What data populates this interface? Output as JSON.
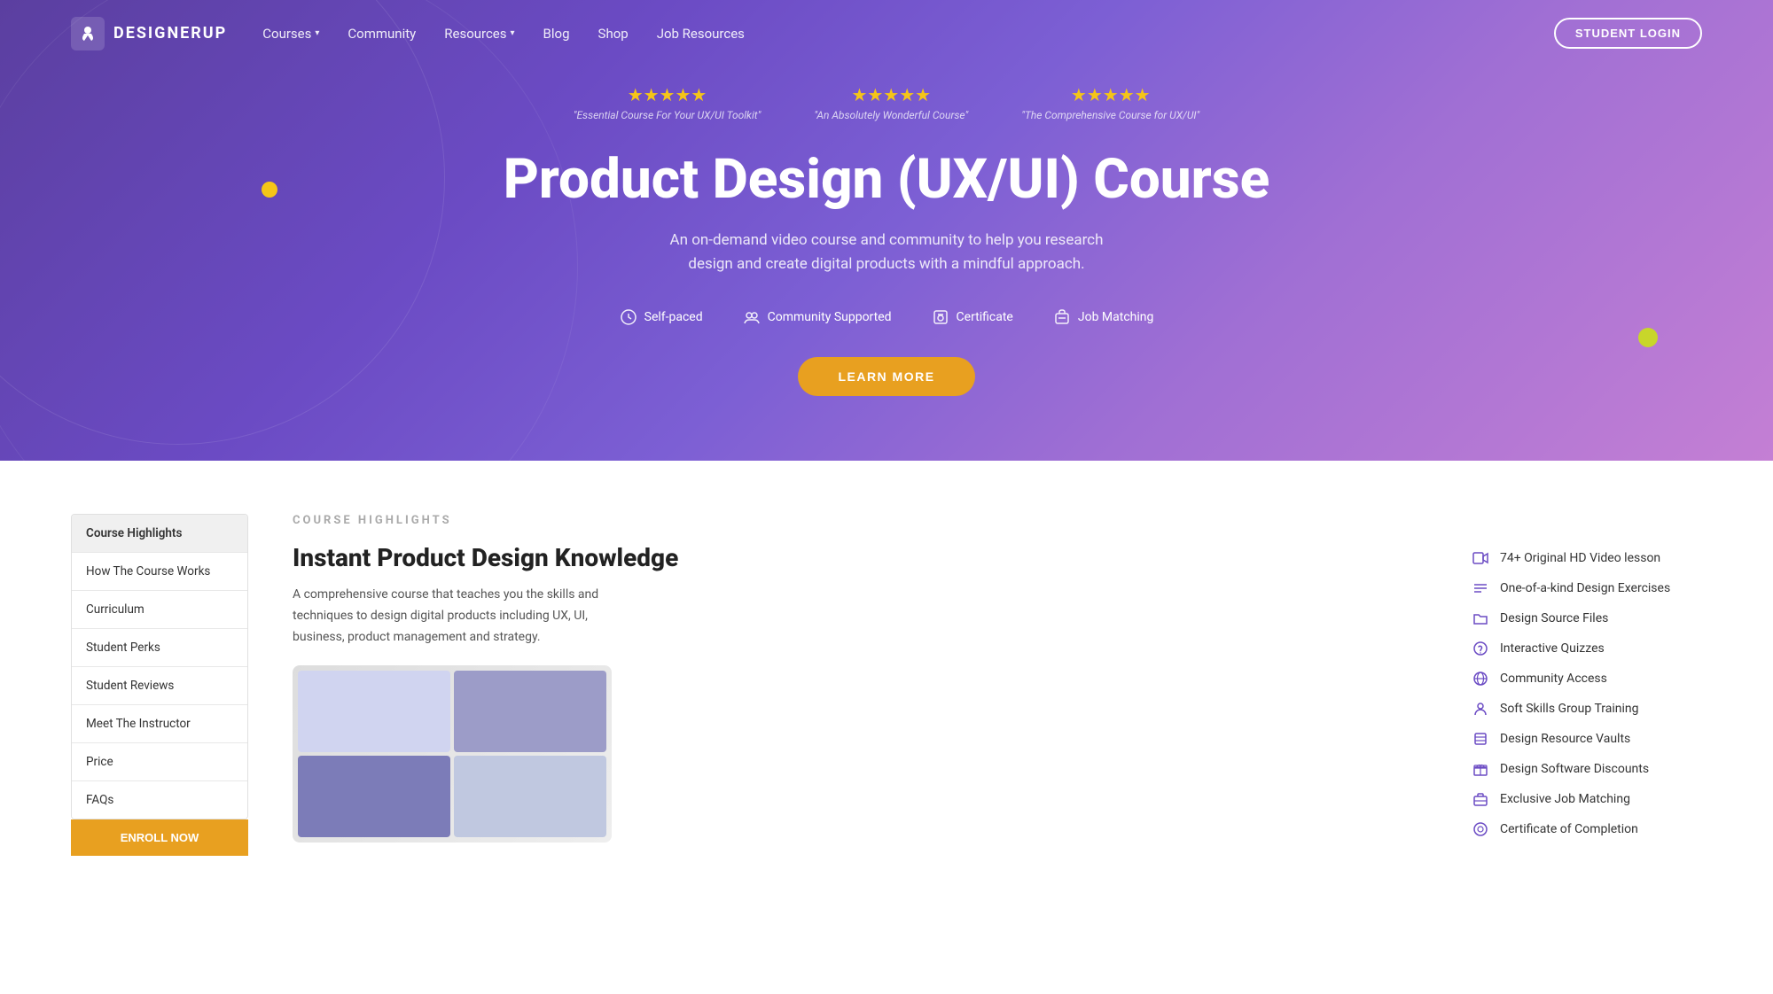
{
  "nav": {
    "logo_text": "DESIGNERUP",
    "links": [
      {
        "label": "Courses",
        "has_dropdown": true
      },
      {
        "label": "Community",
        "has_dropdown": false
      },
      {
        "label": "Resources",
        "has_dropdown": true
      },
      {
        "label": "Blog",
        "has_dropdown": false
      },
      {
        "label": "Shop",
        "has_dropdown": false
      },
      {
        "label": "Job Resources",
        "has_dropdown": false
      }
    ],
    "cta_label": "STUDENT LOGIN"
  },
  "hero": {
    "reviews": [
      {
        "stars": "★★★★★",
        "text": "\"Essential Course For Your UX/UI Toolkit\""
      },
      {
        "stars": "★★★★★",
        "text": "\"An Absolutely Wonderful Course\""
      },
      {
        "stars": "★★★★★",
        "text": "\"The Comprehensive Course for UX/UI\""
      }
    ],
    "title": "Product Design (UX/UI) Course",
    "subtitle": "An on-demand video course and community to help you research design and create digital products with a mindful approach.",
    "features": [
      {
        "icon": "clock",
        "label": "Self-paced"
      },
      {
        "icon": "users",
        "label": "Community Supported"
      },
      {
        "icon": "certificate",
        "label": "Certificate"
      },
      {
        "icon": "briefcase",
        "label": "Job Matching"
      }
    ],
    "cta_label": "LEARN MORE"
  },
  "sidebar": {
    "items": [
      {
        "label": "Course Highlights",
        "active": true
      },
      {
        "label": "How The Course Works",
        "active": false
      },
      {
        "label": "Curriculum",
        "active": false
      },
      {
        "label": "Student Perks",
        "active": false
      },
      {
        "label": "Student Reviews",
        "active": false
      },
      {
        "label": "Meet The Instructor",
        "active": false
      },
      {
        "label": "Price",
        "active": false
      },
      {
        "label": "FAQs",
        "active": false
      }
    ],
    "cta_label": "ENROLL NOW"
  },
  "course_highlights": {
    "section_label": "COURSE HIGHLIGHTS",
    "title": "Instant Product Design Knowledge",
    "description": "A comprehensive course that teaches you the skills and techniques to design digital products including UX, UI, business, product management and strategy.",
    "features": [
      {
        "icon": "video",
        "label": "74+ Original HD Video lesson"
      },
      {
        "icon": "list",
        "label": "One-of-a-kind Design Exercises"
      },
      {
        "icon": "folder",
        "label": "Design Source Files"
      },
      {
        "icon": "help",
        "label": "Interactive Quizzes"
      },
      {
        "icon": "globe",
        "label": "Community Access"
      },
      {
        "icon": "people",
        "label": "Soft Skills Group Training"
      },
      {
        "icon": "database",
        "label": "Design Resource Vaults"
      },
      {
        "icon": "gift",
        "label": "Design Software Discounts"
      },
      {
        "icon": "job",
        "label": "Exclusive Job Matching"
      },
      {
        "icon": "cert",
        "label": "Certificate of Completion"
      }
    ]
  }
}
